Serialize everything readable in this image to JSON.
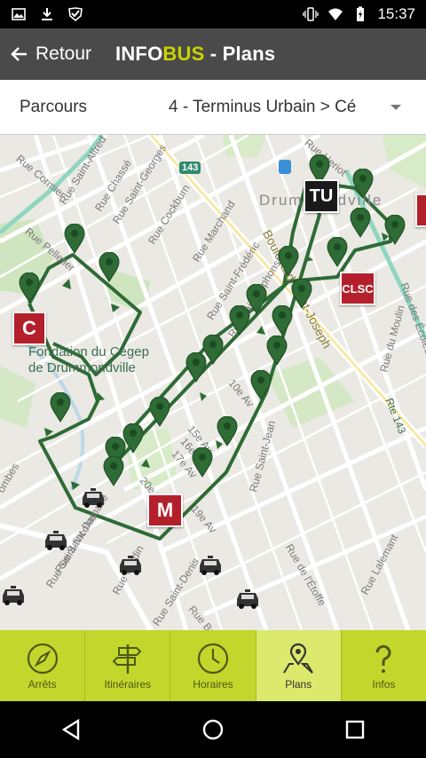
{
  "status": {
    "time": "15:37",
    "icons": [
      "image-icon",
      "download-icon",
      "check-shield-icon",
      "vibrate-icon",
      "wifi-icon",
      "battery-charging-icon"
    ]
  },
  "appbar": {
    "back_label": "Retour",
    "title_info": "INFO",
    "title_bus": "BUS",
    "title_rest": " - Plans"
  },
  "selector": {
    "label": "Parcours",
    "value": "4 - Terminus Urbain > Cé"
  },
  "map": {
    "city": "Drummondville",
    "poi": [
      "Fondation du Cégep",
      "de Drummondville"
    ],
    "markers": {
      "cegep": "C",
      "terminus": "TU",
      "clsc": "CLSC",
      "mall": "M"
    },
    "road_badge": "143",
    "streets": [
      "Rue Cormier",
      "Rue Saint-Alfred",
      "Rue Chassé",
      "Rue Saint-Georges",
      "Rue Cockburn",
      "Rue Marchand",
      "Rue Pelletier",
      "Rue Heriot",
      "Boulevard Saint-Joseph",
      "Rue Saint-Frédéric",
      "Rue Saint-Alphonse",
      "10e Av",
      "15e Av",
      "16e Av",
      "17e Av",
      "19e Av",
      "20e Av",
      "Rue Saint-Jean",
      "Rue Saint-Damase",
      "Rue Saint-Nicolas",
      "Rue Saint-Denis",
      "Rue de l'Étoffe",
      "Rue Lalemant",
      "Rue du Moulin",
      "Rte 143",
      "Rue Cardin",
      "Rue Bertrand",
      "Rue des Écoles",
      "ombes"
    ],
    "route_color": "#2e6b35"
  },
  "tabs": [
    {
      "label": "Arrêts",
      "icon": "compass-icon",
      "active": false
    },
    {
      "label": "Itinéraires",
      "icon": "signpost-icon",
      "active": false
    },
    {
      "label": "Horaires",
      "icon": "clock-icon",
      "active": false
    },
    {
      "label": "Plans",
      "icon": "map-pin-icon",
      "active": true
    },
    {
      "label": "Infos",
      "icon": "question-icon",
      "active": false
    }
  ],
  "colors": {
    "accent": "#c3d62c",
    "brand_bus": "#c8d400",
    "marker_red": "#b3202c",
    "route": "#2e6b35",
    "appbar": "#4a4a4a"
  }
}
